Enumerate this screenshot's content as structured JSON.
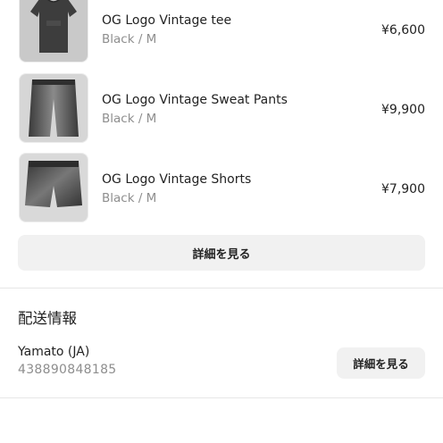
{
  "order_items": [
    {
      "name": "OG Logo Vintage tee",
      "variant": "Black / M",
      "price": "¥6,600",
      "image": "black-tshirt-photo"
    },
    {
      "name": "OG Logo Vintage Sweat Pants",
      "variant": "Black / M",
      "price": "¥9,900",
      "image": "black-sweat-pants-photo"
    },
    {
      "name": "OG Logo Vintage Shorts",
      "variant": "Black / M",
      "price": "¥7,900",
      "image": "black-shorts-photo"
    }
  ],
  "items_details_button": "詳細を見る",
  "shipping": {
    "title": "配送情報",
    "carrier": "Yamato (JA)",
    "tracking_number": "438890848185",
    "details_button": "詳細を見る"
  },
  "colors": {
    "button_bg": "#f1f1f1",
    "muted_text": "#8e8e8e",
    "divider": "#e6e6e6"
  }
}
